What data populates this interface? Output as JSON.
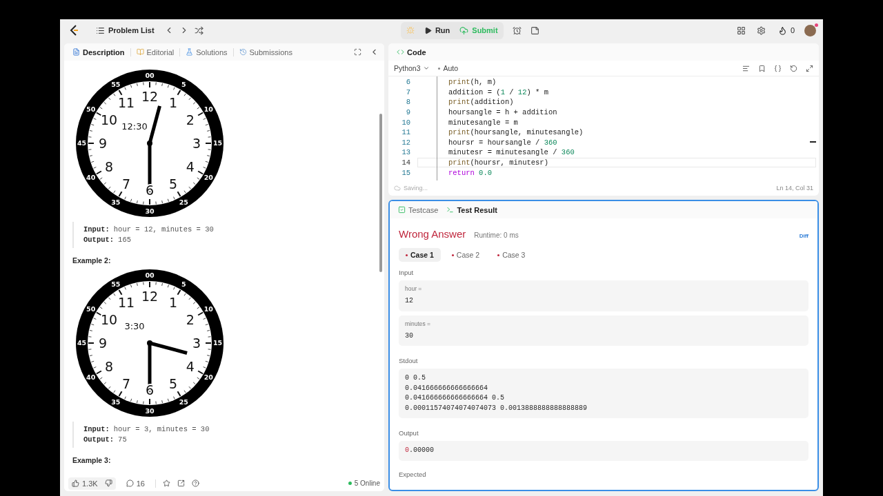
{
  "nav": {
    "problem_list": "Problem List",
    "run": "Run",
    "submit": "Submit",
    "streak": "0"
  },
  "description_panel": {
    "tabs": [
      {
        "label": "Description",
        "selected": true
      },
      {
        "label": "Editorial",
        "selected": false
      },
      {
        "label": "Solutions",
        "selected": false
      },
      {
        "label": "Submissions",
        "selected": false
      }
    ],
    "examples": [
      {
        "kind": "clock",
        "time_label": "12:30",
        "numerals": [
          "11",
          "12",
          "1",
          "10",
          "2",
          "9",
          "3",
          "8",
          "4",
          "7",
          "6",
          "5"
        ],
        "minute_labels": [
          "00",
          "55",
          "5",
          "50",
          "10",
          "45",
          "15",
          "40",
          "20",
          "35",
          "25",
          "30"
        ]
      },
      {
        "kind": "io",
        "input_label": "Input:",
        "input": "hour = 12, minutes = 30",
        "output_label": "Output:",
        "output": "165"
      },
      {
        "kind": "heading",
        "text": "Example 2:"
      },
      {
        "kind": "clock",
        "time_label": "3:30",
        "numerals": [
          "11",
          "12",
          "1",
          "10",
          "2",
          "9",
          "3",
          "8",
          "4",
          "7",
          "6",
          "5"
        ],
        "minute_labels": [
          "00",
          "55",
          "5",
          "50",
          "10",
          "45",
          "15",
          "40",
          "20",
          "35",
          "25",
          "30"
        ]
      },
      {
        "kind": "io",
        "input_label": "Input:",
        "input": "hour = 3, minutes = 30",
        "output_label": "Output:",
        "output": "75"
      },
      {
        "kind": "heading",
        "text": "Example 3:"
      }
    ],
    "footer": {
      "likes": "1.3K",
      "comments": "16",
      "online": "5 Online"
    }
  },
  "code_panel": {
    "title": "Code",
    "language": "Python3",
    "mode": "Auto",
    "lines": [
      {
        "number": "6",
        "current": false,
        "tokens": [
          {
            "t": "print",
            "kind": "fn"
          },
          {
            "t": "(h, m)",
            "kind": "plain"
          }
        ]
      },
      {
        "number": "7",
        "current": false,
        "tokens": [
          {
            "t": "addition = (",
            "kind": "plain"
          },
          {
            "t": "1",
            "kind": "num"
          },
          {
            "t": " / ",
            "kind": "plain"
          },
          {
            "t": "12",
            "kind": "num"
          },
          {
            "t": ") * m",
            "kind": "plain"
          }
        ]
      },
      {
        "number": "8",
        "current": false,
        "tokens": [
          {
            "t": "print",
            "kind": "fn"
          },
          {
            "t": "(addition)",
            "kind": "plain"
          }
        ]
      },
      {
        "number": "9",
        "current": false,
        "tokens": [
          {
            "t": "hoursangle = h + addition",
            "kind": "plain"
          }
        ]
      },
      {
        "number": "10",
        "current": false,
        "tokens": [
          {
            "t": "minutesangle = m",
            "kind": "plain"
          }
        ]
      },
      {
        "number": "11",
        "current": false,
        "tokens": [
          {
            "t": "print",
            "kind": "fn"
          },
          {
            "t": "(hoursangle, minutesangle)",
            "kind": "plain"
          }
        ]
      },
      {
        "number": "12",
        "current": false,
        "tokens": [
          {
            "t": "hoursr = hoursangle / ",
            "kind": "plain"
          },
          {
            "t": "360",
            "kind": "num"
          }
        ]
      },
      {
        "number": "13",
        "current": false,
        "tokens": [
          {
            "t": "minutesr = minutesangle / ",
            "kind": "plain"
          },
          {
            "t": "360",
            "kind": "num"
          }
        ]
      },
      {
        "number": "14",
        "current": true,
        "tokens": [
          {
            "t": "print",
            "kind": "fn"
          },
          {
            "t": "(hoursr, minutesr)",
            "kind": "plain"
          }
        ]
      },
      {
        "number": "15",
        "current": false,
        "tokens": [
          {
            "t": "return",
            "kind": "kw"
          },
          {
            "t": " 0.0",
            "kind": "num"
          }
        ]
      }
    ],
    "status": "Saving...",
    "cursor": "Ln 14, Col 31"
  },
  "result_panel": {
    "tabs": [
      {
        "label": "Testcase",
        "selected": false
      },
      {
        "label": "Test Result",
        "selected": true
      }
    ],
    "verdict": "Wrong Answer",
    "runtime": "Runtime: 0 ms",
    "diff": "Diff",
    "cases": [
      {
        "label": "Case 1",
        "selected": true,
        "passed": false
      },
      {
        "label": "Case 2",
        "selected": false,
        "passed": false
      },
      {
        "label": "Case 3",
        "selected": false,
        "passed": false
      }
    ],
    "input_label": "Input",
    "inputs": [
      {
        "name": "hour =",
        "value": "12"
      },
      {
        "name": "minutes =",
        "value": "30"
      }
    ],
    "stdout_label": "Stdout",
    "stdout": [
      "0 0.5",
      "0.041666666666666664",
      "0.041666666666666664 0.5",
      "0.00011574074074074073 0.0013888888888888889"
    ],
    "output_label": "Output",
    "output": [
      {
        "text": "0",
        "diff": true
      },
      {
        "text": ".00000",
        "diff": false
      }
    ],
    "expected_label": "Expected"
  }
}
